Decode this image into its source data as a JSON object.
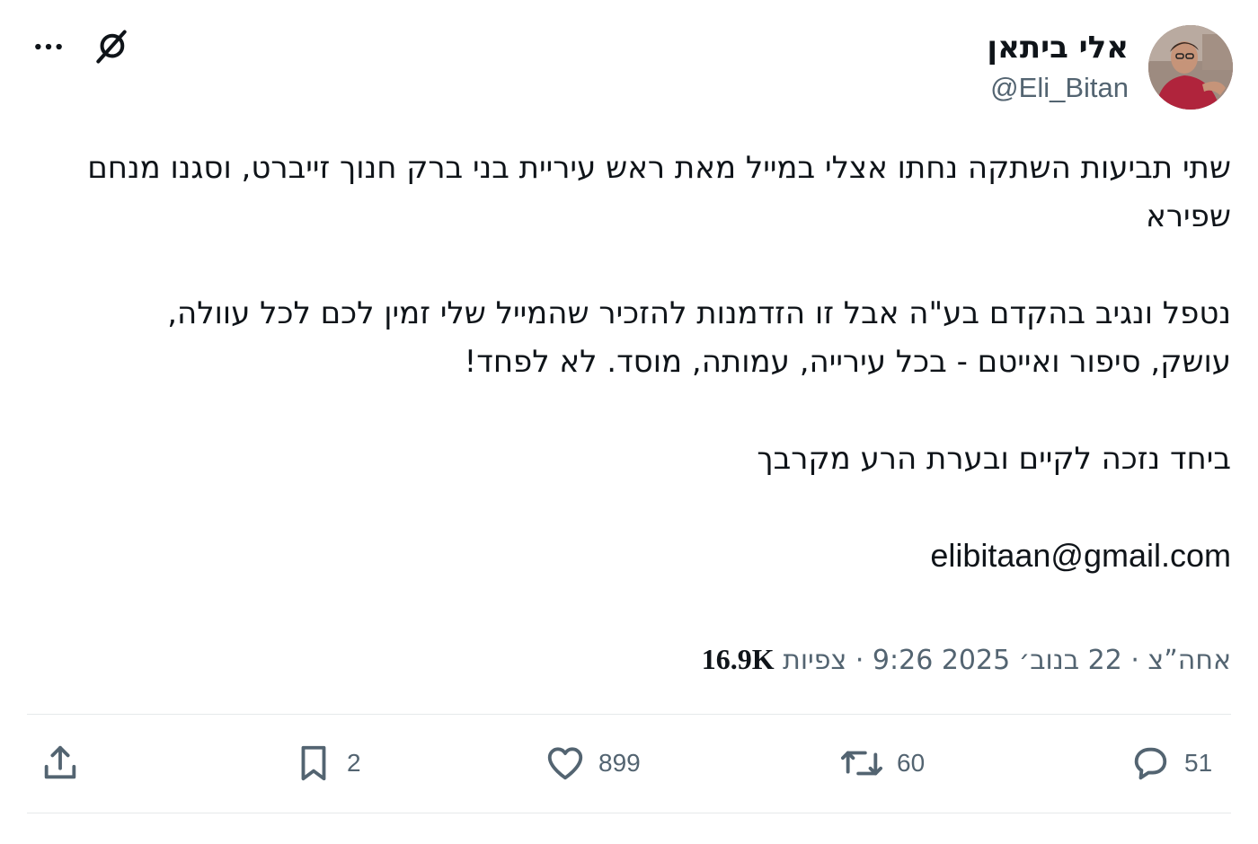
{
  "author": {
    "display_name": "אלי ביתאן",
    "handle": "@Eli_Bitan"
  },
  "tweet": {
    "paragraphs": [
      "שתי תביעות השתקה נחתו אצלי במייל מאת ראש עיריית בני ברק חנוך זייברט, וסגנו מנחם שפירא",
      "נטפל ונגיב בהקדם בע\"ה אבל זו הזדמנות להזכיר שהמייל שלי זמין לכם לכל עוולה, עושק, סיפור ואייטם - בכל עירייה, עמותה, מוסד. לא לפחד!",
      "ביחד נזכה לקיים ובערת הרע מקרבך"
    ],
    "email": "elibitaan@gmail.com"
  },
  "meta": {
    "time": "אחה״צ",
    "date": "9:26 2025 22 בנוב׳",
    "date_display": "אחה”צ · 22 בנוב׳ 2025 9:26 ·",
    "views_count": "16.9K",
    "views_label": "צפיות"
  },
  "actions": {
    "replies": "51",
    "reposts": "60",
    "likes": "899",
    "bookmarks": "2"
  },
  "icons": {
    "more": "more-horizontal-icon",
    "grok": "grok-icon",
    "reply": "reply-icon",
    "repost": "repost-icon",
    "like": "heart-icon",
    "bookmark": "bookmark-icon",
    "share": "share-icon"
  },
  "colors": {
    "text": "#0f1419",
    "secondary": "#536471",
    "divider": "#e6e9eb"
  }
}
